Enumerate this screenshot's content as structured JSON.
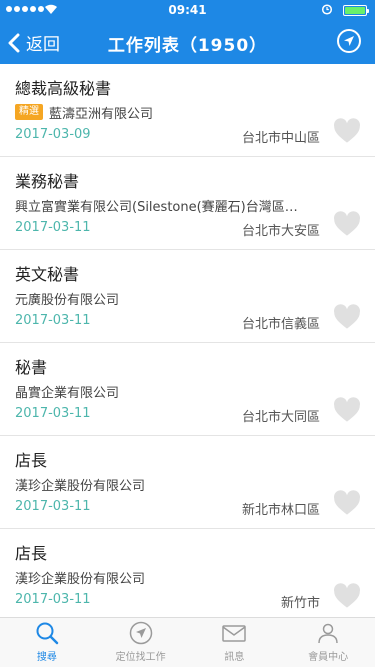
{
  "status_bar": {
    "time": "09:41",
    "battery_level": 1.0
  },
  "nav": {
    "back_label": "返回",
    "title": "工作列表（1950）"
  },
  "jobs": [
    {
      "title": "總裁高級秘書",
      "badge": "精選",
      "company": "藍濤亞洲有限公司",
      "date": "2017-03-09",
      "location": "台北市中山區"
    },
    {
      "title": "業務秘書",
      "badge": "",
      "company": "興立富實業有限公司(Silestone(賽麗石)台灣區…",
      "date": "2017-03-11",
      "location": "台北市大安區"
    },
    {
      "title": "英文秘書",
      "badge": "",
      "company": "元廣股份有限公司",
      "date": "2017-03-11",
      "location": "台北市信義區"
    },
    {
      "title": "秘書",
      "badge": "",
      "company": "晶實企業有限公司",
      "date": "2017-03-11",
      "location": "台北市大同區"
    },
    {
      "title": "店長",
      "badge": "",
      "company": "漢珍企業股份有限公司",
      "date": "2017-03-11",
      "location": "新北市林口區"
    },
    {
      "title": "店長",
      "badge": "",
      "company": "漢珍企業股份有限公司",
      "date": "2017-03-11",
      "location": "新竹市"
    }
  ],
  "tabs": [
    {
      "label": "搜尋",
      "icon": "search-icon",
      "active": true
    },
    {
      "label": "定位找工作",
      "icon": "location-arrow-icon",
      "active": false
    },
    {
      "label": "訊息",
      "icon": "envelope-icon",
      "active": false
    },
    {
      "label": "會員中心",
      "icon": "user-icon",
      "active": false
    }
  ],
  "colors": {
    "primary": "#1e88e5",
    "badge": "#f5a623",
    "date": "#4db6ac",
    "heart": "#e0e0e0"
  }
}
